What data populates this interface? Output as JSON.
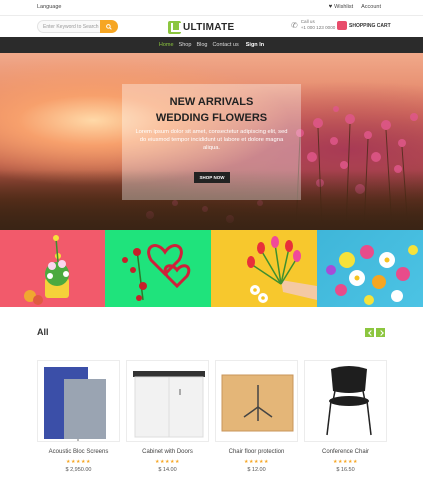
{
  "topbar": {
    "language": "Language",
    "wishlist": "Wishlist",
    "account": "Account"
  },
  "header": {
    "search_placeholder": "Enter Keyword to Search",
    "logo_text": "ULTIMATE",
    "call_label": "Call us",
    "call_number": "+1 000 123 0000",
    "cart_label": "SHOPPING CART"
  },
  "nav": {
    "items": [
      "Home",
      "Shop",
      "Blog",
      "Contact us"
    ],
    "signin": "Sign In"
  },
  "hero": {
    "title_line1": "NEW ARRIVALS",
    "title_line2": "WEDDING FLOWERS",
    "description": "Lorem ipsum dolor sit amet, consectetur adipiscing elit, sed do eiusmod tempor incididunt ut labore et dolore magna aliqua.",
    "button": "SHOP NOW"
  },
  "section": {
    "title": "All"
  },
  "products": [
    {
      "name": "Acoustic Bloc Screens",
      "price": "$ 2,950.00",
      "stars": "★★★★★"
    },
    {
      "name": "Cabinet with Doors",
      "price": "$ 14.00",
      "stars": "★★★★★"
    },
    {
      "name": "Chair floor protection",
      "price": "$ 12.00",
      "stars": "★★★★★"
    },
    {
      "name": "Conference Chair",
      "price": "$ 16.50",
      "stars": "★★★★★"
    }
  ],
  "colors": {
    "accent": "#8cc63f",
    "search_button": "#f6a623",
    "nav_bg": "#2b2b2b",
    "cart_icon": "#e84c6b"
  }
}
